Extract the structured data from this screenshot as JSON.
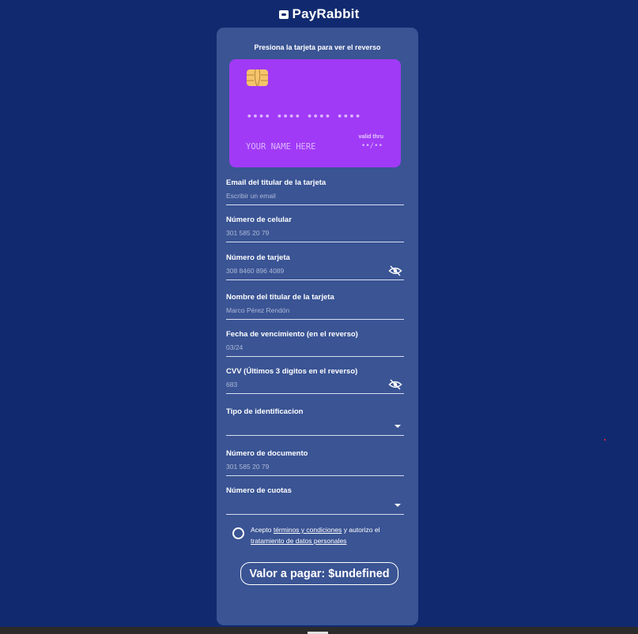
{
  "brand": {
    "name": "PayRabbit",
    "icon": "card-logo-icon"
  },
  "card_hint": "Presiona la tarjeta para ver el reverso",
  "card_preview": {
    "number": "•••• •••• •••• ••••",
    "holder": "YOUR NAME HERE",
    "valid_label": "valid thru",
    "valid_value": "••/••",
    "color": "#a13af6",
    "chip_color": "#f5c46b"
  },
  "fields": {
    "email": {
      "label": "Email del titular de la tarjeta",
      "placeholder": "Escribir un email"
    },
    "phone": {
      "label": "Número de celular",
      "placeholder": "301 585 20 79"
    },
    "card_number": {
      "label": "Número de tarjeta",
      "placeholder": "308 8460 896 4089",
      "icon": "eye-off-icon"
    },
    "holder": {
      "label": "Nombre del titular de la tarjeta",
      "placeholder": "Marco Pérez Rendón"
    },
    "expiry": {
      "label": "Fecha de vencimiento (en el reverso)",
      "placeholder": "03/24"
    },
    "cvv": {
      "label": "CVV (Últimos 3 digitos en el reverso)",
      "placeholder": "683",
      "icon": "eye-off-icon"
    },
    "id_type": {
      "label": "Tipo de identificacion",
      "value": ""
    },
    "doc_number": {
      "label": "Número de documento",
      "placeholder": "301 585 20 79"
    },
    "installments": {
      "label": "Número de cuotas",
      "value": ""
    }
  },
  "terms": {
    "prefix": "Acepto",
    "link1": "términos y condiciones",
    "middle": "y autorizo el",
    "link2": "tratamiento de datos personales"
  },
  "pay_button": "Valor a pagar: $undefined",
  "colors": {
    "background": "#112a6f",
    "panel": "#3a5494"
  }
}
